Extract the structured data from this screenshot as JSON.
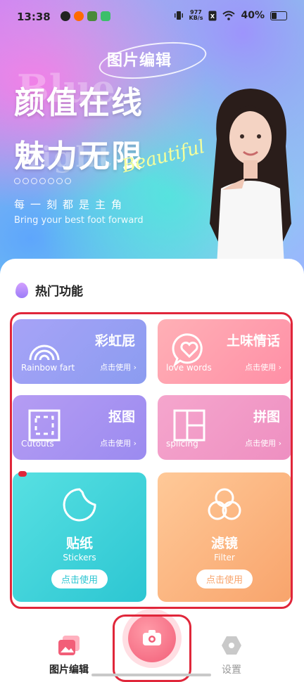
{
  "status_bar": {
    "time": "13:38",
    "net_speed_value": "977",
    "net_speed_unit": "KB/s",
    "battery": "40%",
    "battery_level": 0.4
  },
  "hero": {
    "badge": "图片编辑",
    "line1": "颜值在线",
    "line2": "魅力无限",
    "script_text": "Beautiful",
    "ghost_text_1": "Blue",
    "ghost_text_2": "light",
    "subtitle_cn": "每一刻都是主角",
    "subtitle_en": "Bring your best foot forward"
  },
  "section": {
    "title": "热门功能"
  },
  "features": [
    {
      "title": "彩虹屁",
      "en": "Rainbow fart",
      "action": "点击使用 ›",
      "icon": "rainbow-icon"
    },
    {
      "title": "土味情话",
      "en": "love words",
      "action": "点击使用 ›",
      "icon": "heart-chat-icon"
    },
    {
      "title": "抠图",
      "en": "Cutouts",
      "action": "点击使用 ›",
      "icon": "cutout-frame-icon"
    },
    {
      "title": "拼图",
      "en": "splicing",
      "action": "点击使用 ›",
      "icon": "grid-icon"
    },
    {
      "title": "贴纸",
      "en": "Stickers",
      "action": "点击使用",
      "icon": "sticker-icon"
    },
    {
      "title": "滤镜",
      "en": "Filter",
      "action": "点击使用",
      "icon": "filter-icon"
    }
  ],
  "tabs": [
    {
      "label": "图片编辑",
      "icon": "gallery-icon",
      "active": true
    },
    {
      "label": "设置",
      "icon": "hexagon-icon",
      "active": false
    }
  ],
  "camera_fab": {
    "icon": "camera-icon"
  },
  "colors": {
    "accent_red_outline": "#e0263a",
    "rainbow_card": "#9aa0f5",
    "love_card": "#ff9fb0",
    "cutout_card": "#a48cf2",
    "splice_card": "#f4a0c8",
    "sticker_card": "#3fd3d8",
    "filter_card": "#f8b07e",
    "camera": "#f25e78"
  }
}
